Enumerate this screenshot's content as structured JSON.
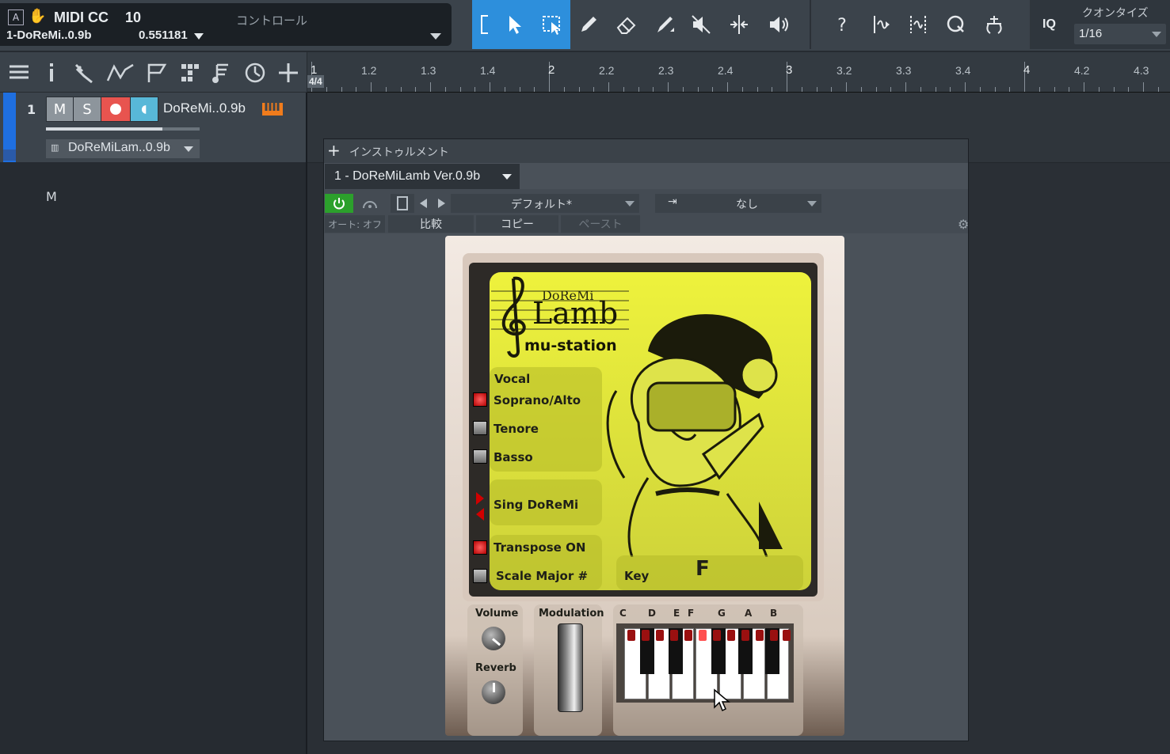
{
  "topbar": {
    "cc_label": "MIDI CC",
    "cc_value": "10",
    "track_name": "1-DoReMi..0.9b",
    "param_value": "0.551181",
    "control_label": "コントロール",
    "iq_label": "IQ",
    "quantize_label": "クオンタイズ",
    "quantize_value": "1/16",
    "tools": [
      "bracket-icon",
      "arrow-icon",
      "range-icon",
      "pencil-icon",
      "eraser-icon",
      "paint-icon",
      "mute-icon",
      "split-icon",
      "listen-icon",
      "help-icon",
      "bend-icon",
      "stretch-icon",
      "quantize-q-icon",
      "quantize-icon"
    ]
  },
  "header": {
    "icons": [
      "list-icon",
      "info-icon",
      "wrench-icon",
      "automation-icon",
      "marker-icon",
      "grid-icon",
      "notes-icon",
      "clock-icon",
      "add-icon"
    ]
  },
  "ruler": {
    "time_signature": "4/4",
    "labels": [
      "1",
      "1.2",
      "1.3",
      "1.4",
      "2",
      "2.2",
      "2.3",
      "2.4",
      "3",
      "3.2",
      "3.3",
      "3.4",
      "4",
      "4.2",
      "4.3"
    ]
  },
  "track": {
    "number": "1",
    "mute": "M",
    "solo": "S",
    "name": "DoReMi..0.9b",
    "instrument": "DoReMiLam..0.9b",
    "accent_color": "#1f6fe0",
    "record_color": "#e8544f",
    "monitor_color": "#58b8d8"
  },
  "instrument_window": {
    "title": "インストゥルメント",
    "plugin_tab": "1 - DoReMiLamb Ver.0.9b",
    "preset": "デフォルト*",
    "sidechain": "なし",
    "auto": "オート: オフ",
    "compare": "比較",
    "copy": "コピー",
    "paste": "ペースト"
  },
  "plugin": {
    "logo_top": "DoReMi",
    "logo_main": "Lamb",
    "logo_sub": "mu-station",
    "vocal_label": "Vocal",
    "voices": [
      {
        "label": "Soprano/Alto",
        "on": true
      },
      {
        "label": "Tenore",
        "on": false
      },
      {
        "label": "Basso",
        "on": false
      }
    ],
    "sing_label": "Sing DoReMi",
    "transpose": {
      "label": "Transpose ON",
      "on": true
    },
    "scale": {
      "label": "Scale Major #",
      "on": false
    },
    "key_label": "Key",
    "key_value": "F",
    "volume_label": "Volume",
    "reverb_label": "Reverb",
    "modulation_label": "Modulation",
    "note_labels": [
      "C",
      "D",
      "E",
      "F",
      "G",
      "A",
      "B"
    ],
    "accent_color": "#e2ee3a"
  }
}
